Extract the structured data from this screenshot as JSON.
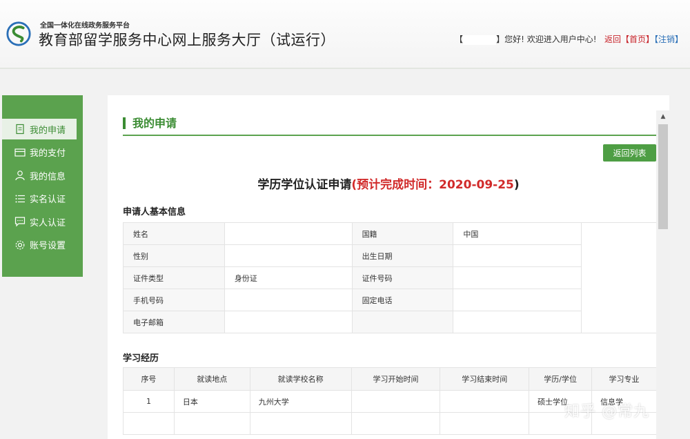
{
  "header": {
    "platform": "全国一体化在线政务服务平台",
    "title": "教育部留学服务中心网上服务大厅（试运行）",
    "welcome_prefix": "【",
    "welcome_suffix": "】您好! 欢迎进入用户中心!",
    "back_link": "返回",
    "home_link": "【首页】",
    "logout_link": "【注销】"
  },
  "sidebar": {
    "items": [
      {
        "label": "我的申请",
        "icon": "document-icon"
      },
      {
        "label": "我的支付",
        "icon": "card-icon"
      },
      {
        "label": "我的信息",
        "icon": "user-icon"
      },
      {
        "label": "实名认证",
        "icon": "list-icon"
      },
      {
        "label": "实人认证",
        "icon": "chat-icon"
      },
      {
        "label": "账号设置",
        "icon": "gear-icon"
      }
    ]
  },
  "main": {
    "section_title": "我的申请",
    "back_button": "返回列表",
    "doc_title": "学历学位认证申请",
    "doc_paren_open": "(",
    "doc_estimate": "预计完成时间：2020-09-25",
    "doc_paren_close": ")",
    "basic_info_heading": "申请人基本信息",
    "basic_info": {
      "name_label": "姓名",
      "name_value": "",
      "nationality_label": "国籍",
      "nationality_value": "中国",
      "gender_label": "性别",
      "gender_value": "",
      "birth_label": "出生日期",
      "birth_value": "",
      "idtype_label": "证件类型",
      "idtype_value": "身份证",
      "idno_label": "证件号码",
      "idno_value": "",
      "mobile_label": "手机号码",
      "mobile_value": "",
      "phone_label": "固定电话",
      "phone_value": "",
      "email_label": "电子邮箱",
      "email_value": ""
    },
    "study_heading": "学习经历",
    "study_columns": [
      "序号",
      "就读地点",
      "就读学校名称",
      "学习开始时间",
      "学习结束时间",
      "学历/学位",
      "学习专业"
    ],
    "study_rows": [
      [
        "1",
        "日本",
        "九州大学",
        "",
        "",
        "硕士学位",
        "信息学"
      ]
    ]
  },
  "watermark": "知乎 @常九",
  "colors": {
    "brand_green": "#5ba24e",
    "accent_red": "#d12a2a",
    "link_blue": "#2a6fb7"
  }
}
